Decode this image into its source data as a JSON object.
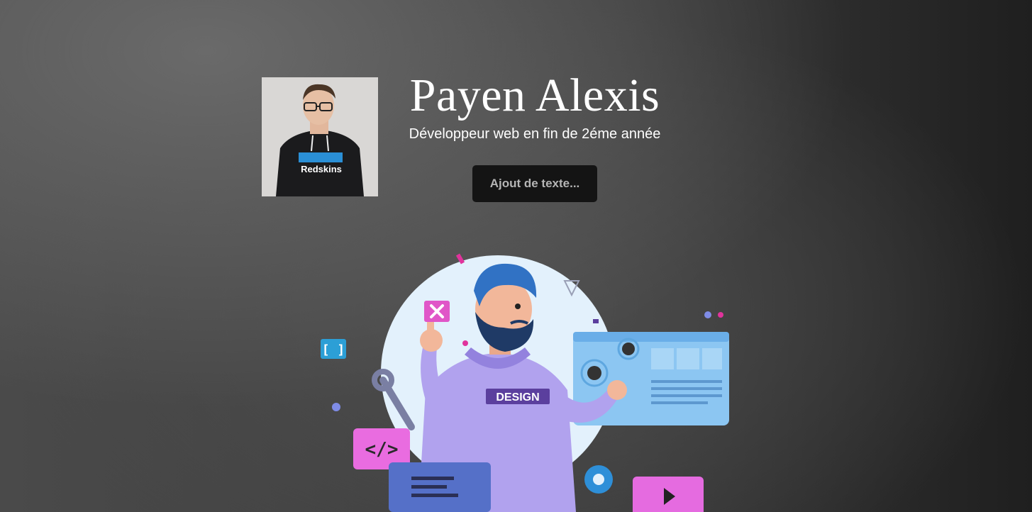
{
  "header": {
    "name": "Payen Alexis",
    "subtitle": "Développeur web en fin de 2éme année",
    "button_label": "Ajout de texte..."
  },
  "avatar": {
    "hoodie_text": "Redskins"
  },
  "illustration": {
    "shirt_text": "DESIGN",
    "icons": [
      "close-icon",
      "brackets-icon",
      "code-icon",
      "wrench-icon",
      "gear-icon",
      "play-icon",
      "browser-window-icon"
    ]
  },
  "colors": {
    "accent_purple": "#a89be8",
    "pink": "#e056c8",
    "blue": "#5aaee8",
    "button_bg": "#141414"
  }
}
